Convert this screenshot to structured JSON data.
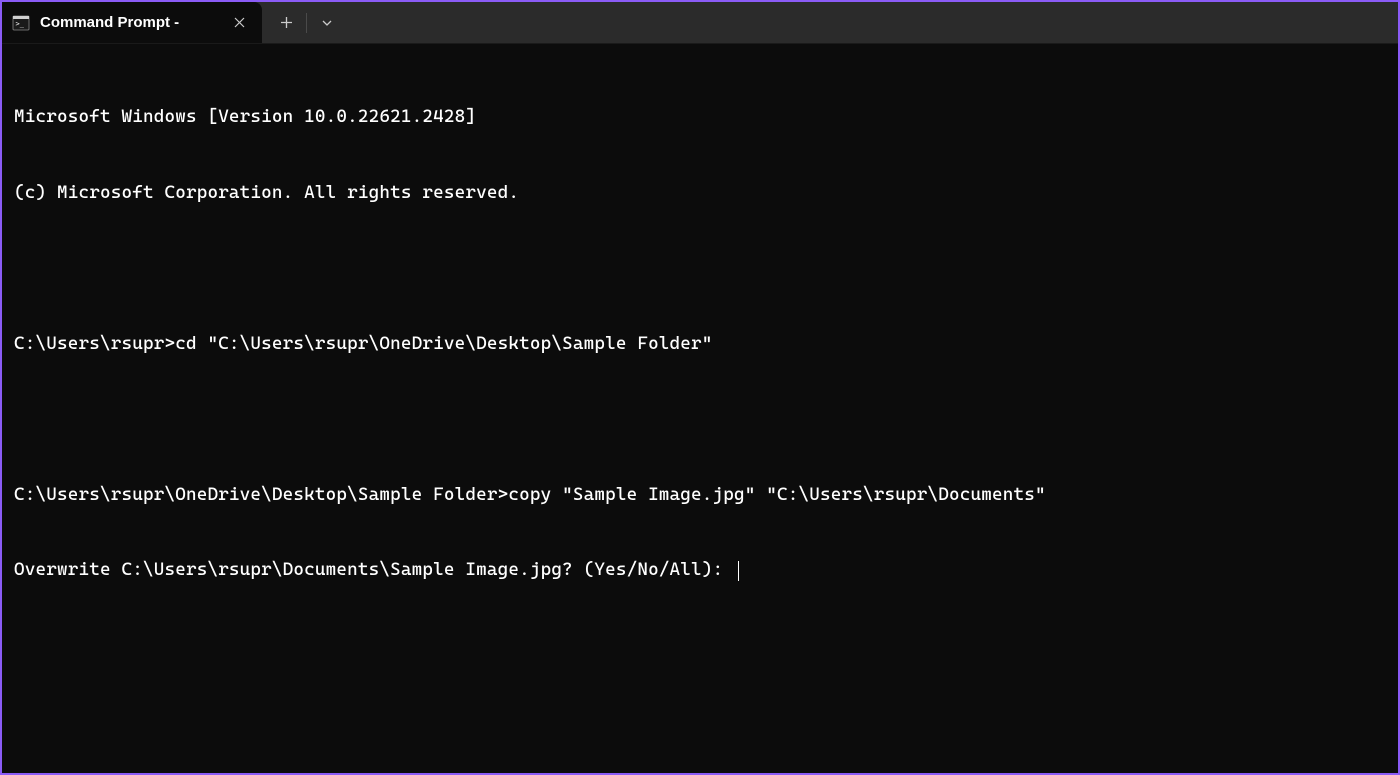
{
  "tab": {
    "title": "Command Prompt -"
  },
  "terminal": {
    "lines": [
      "Microsoft Windows [Version 10.0.22621.2428]",
      "(c) Microsoft Corporation. All rights reserved.",
      "",
      "C:\\Users\\rsupr>cd \"C:\\Users\\rsupr\\OneDrive\\Desktop\\Sample Folder\"",
      "",
      "C:\\Users\\rsupr\\OneDrive\\Desktop\\Sample Folder>copy \"Sample Image.jpg\" \"C:\\Users\\rsupr\\Documents\"",
      "Overwrite C:\\Users\\rsupr\\Documents\\Sample Image.jpg? (Yes/No/All): "
    ]
  }
}
